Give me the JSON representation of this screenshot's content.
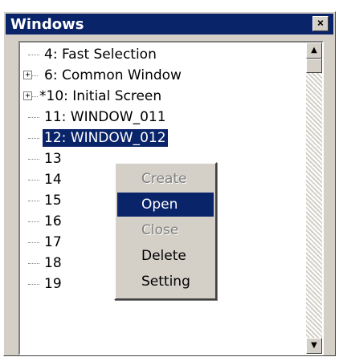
{
  "window": {
    "title": "Windows",
    "close_glyph": "×"
  },
  "tree": {
    "items": [
      {
        "label": "4: Fast Selection",
        "expandable": false,
        "selected": false
      },
      {
        "label": "6: Common Window",
        "expandable": true,
        "selected": false
      },
      {
        "label": "*10: Initial Screen",
        "expandable": true,
        "selected": false
      },
      {
        "label": "11: WINDOW_011",
        "expandable": false,
        "selected": false
      },
      {
        "label": "12: WINDOW_012",
        "expandable": false,
        "selected": true
      },
      {
        "label": "13",
        "expandable": false,
        "selected": false
      },
      {
        "label": "14",
        "expandable": false,
        "selected": false
      },
      {
        "label": "15",
        "expandable": false,
        "selected": false
      },
      {
        "label": "16",
        "expandable": false,
        "selected": false
      },
      {
        "label": "17",
        "expandable": false,
        "selected": false
      },
      {
        "label": "18",
        "expandable": false,
        "selected": false
      },
      {
        "label": "19",
        "expandable": false,
        "selected": false
      }
    ],
    "expander_glyph": "+"
  },
  "context_menu": {
    "items": [
      {
        "label": "Create",
        "state": "disabled"
      },
      {
        "label": "Open",
        "state": "active"
      },
      {
        "label": "Close",
        "state": "disabled"
      },
      {
        "label": "Delete",
        "state": "normal"
      },
      {
        "label": "Setting",
        "state": "normal"
      }
    ]
  },
  "scrollbar": {
    "up_glyph": "▲",
    "down_glyph": "▼"
  },
  "icons": {
    "close": "close-icon",
    "expander": "plus-icon",
    "up": "arrow-up-icon",
    "down": "arrow-down-icon"
  },
  "colors": {
    "selection": "#0a246a",
    "face": "#d4d0c8",
    "disabled_text": "#808080"
  }
}
